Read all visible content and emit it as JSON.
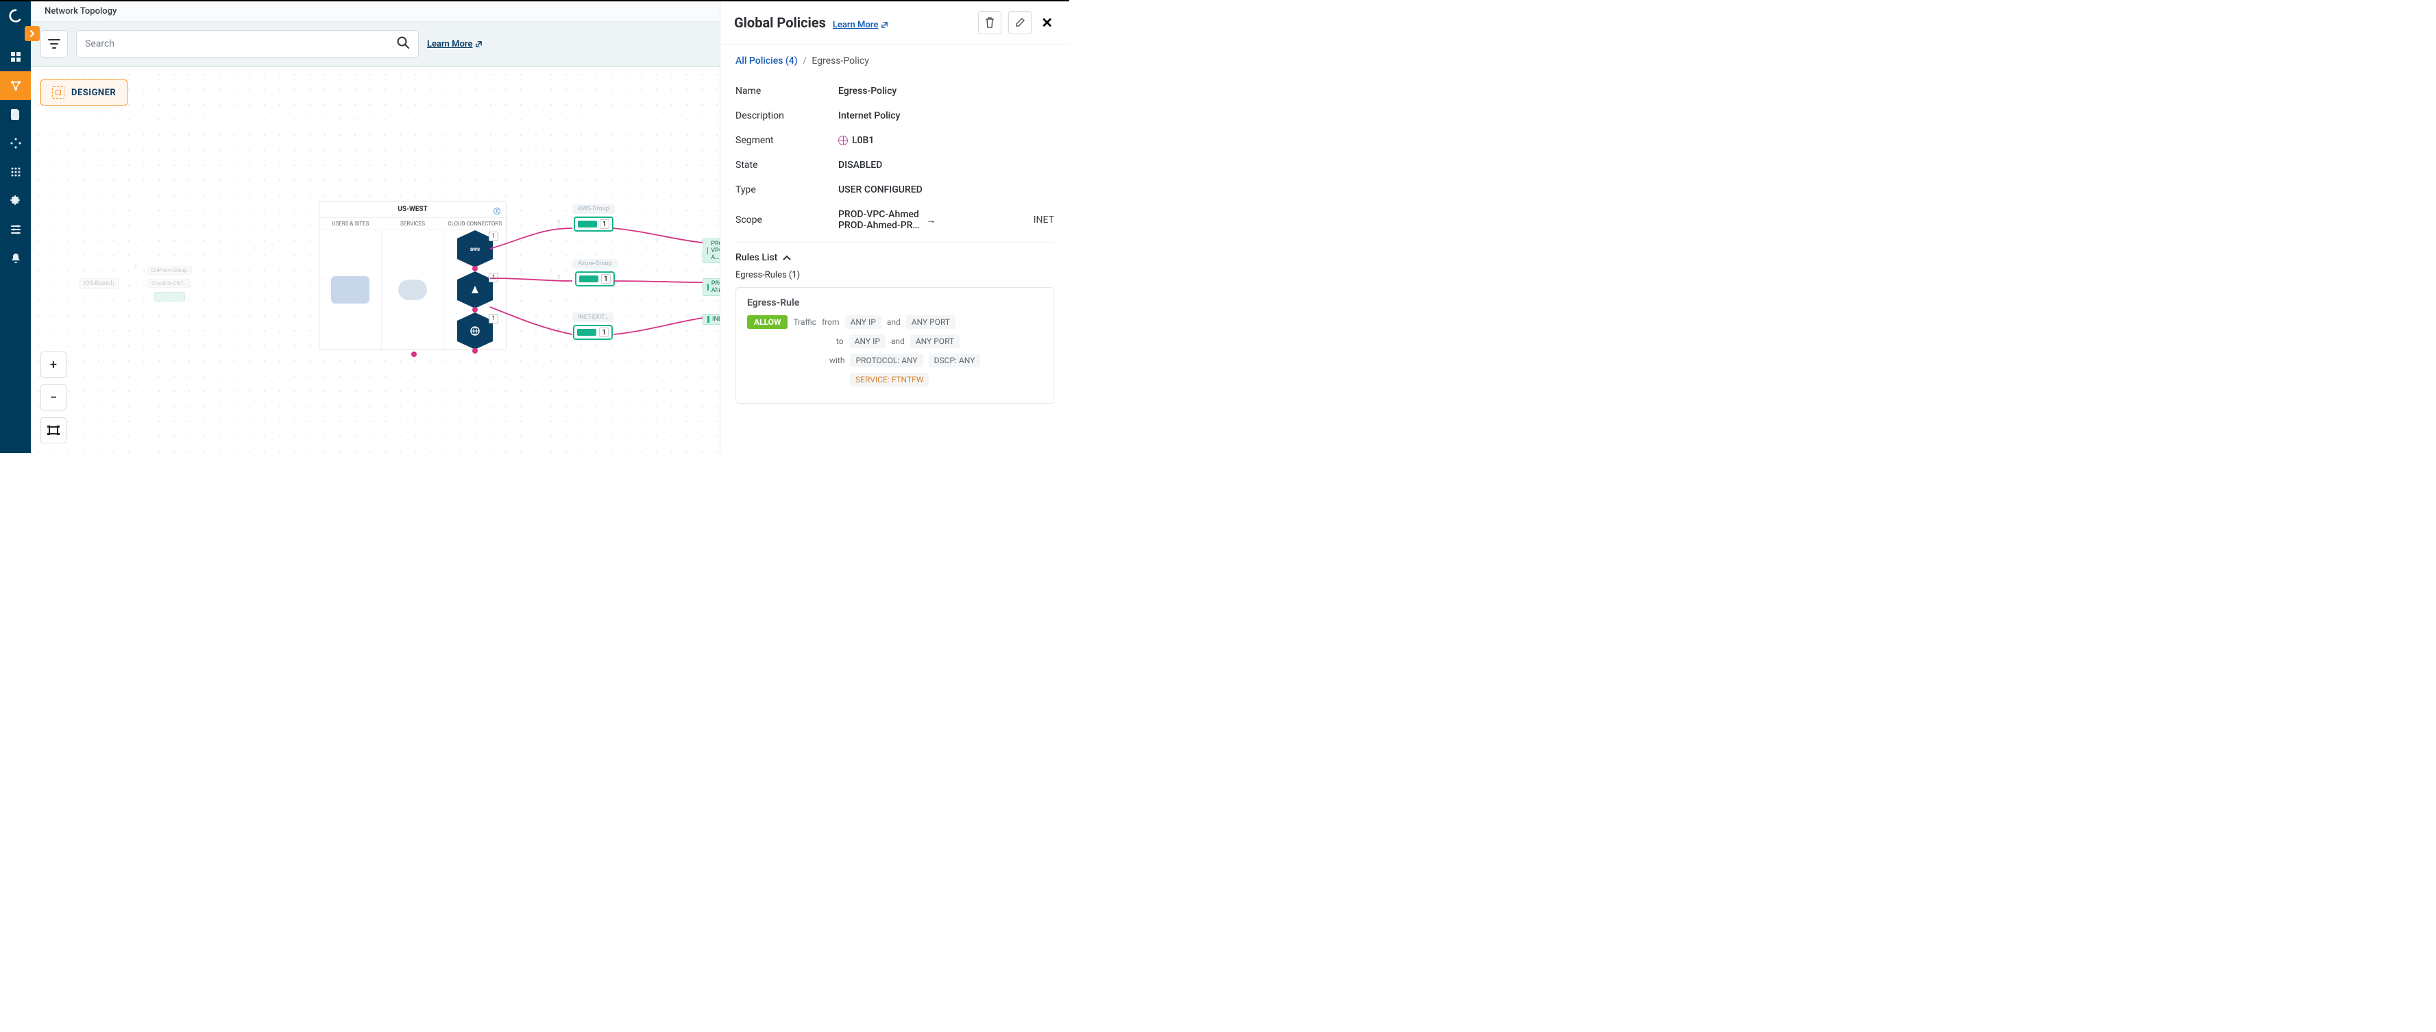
{
  "header": {
    "title": "Network Topology"
  },
  "toolbar": {
    "search_placeholder": "Search",
    "learn_more": "Learn More"
  },
  "canvas": {
    "designer_label": "DESIGNER",
    "region": {
      "name": "US-WEST",
      "cols": [
        "USERS & SITES",
        "SERVICES",
        "CLOUD CONNECTORS"
      ],
      "connector_badge": "1"
    },
    "groups": [
      {
        "label": "AWS-Group",
        "badge": "1",
        "count": "1"
      },
      {
        "label": "Azure-Group",
        "badge": "1",
        "count": "1"
      },
      {
        "label": "INET-EXIT…",
        "badge": "1",
        "count": "1"
      }
    ],
    "targets": [
      "PROD-VPC-A…",
      "PROD-Ahmed…",
      "INET"
    ],
    "faded": {
      "branch": "IOS-Branch",
      "onprem": "OnPrem-Group",
      "cloud": "Cloud-Ix-CNT…",
      "badge": "1"
    }
  },
  "panel": {
    "title": "Global Policies",
    "learn_more": "Learn More",
    "crumb": {
      "all": "All Policies (4)",
      "current": "Egress-Policy"
    },
    "fields": {
      "name_label": "Name",
      "name_value": "Egress-Policy",
      "desc_label": "Description",
      "desc_value": "Internet Policy",
      "seg_label": "Segment",
      "seg_value": "L0B1",
      "state_label": "State",
      "state_value": "DISABLED",
      "type_label": "Type",
      "type_value": "USER CONFIGURED",
      "scope_label": "Scope",
      "scope_from1": "PROD-VPC-Ahmed",
      "scope_from2": "PROD-Ahmed-PR…",
      "scope_to": "INET"
    },
    "rules": {
      "list_label": "Rules List",
      "group_label": "Egress-Rules (1)",
      "rule_title": "Egress-Rule",
      "allow": "ALLOW",
      "traffic": "Traffic",
      "from": "from",
      "to": "to",
      "with": "with",
      "and": "and",
      "any_ip": "ANY IP",
      "any_port": "ANY PORT",
      "protocol": "PROTOCOL: ANY",
      "dscp": "DSCP: ANY",
      "service": "SERVICE: FTNTFW"
    }
  }
}
